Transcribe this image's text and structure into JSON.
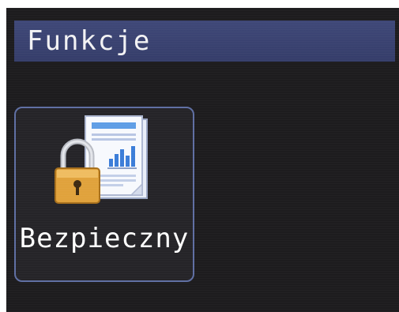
{
  "header": {
    "title": "Funkcje"
  },
  "tiles": [
    {
      "label": "Bezpieczny",
      "icon": "secure-document-lock-icon"
    }
  ],
  "colors": {
    "background": "#1d1c1e",
    "title_bar": "#3f4878",
    "tile_border": "#5f6fa3",
    "text": "#ffffff"
  }
}
